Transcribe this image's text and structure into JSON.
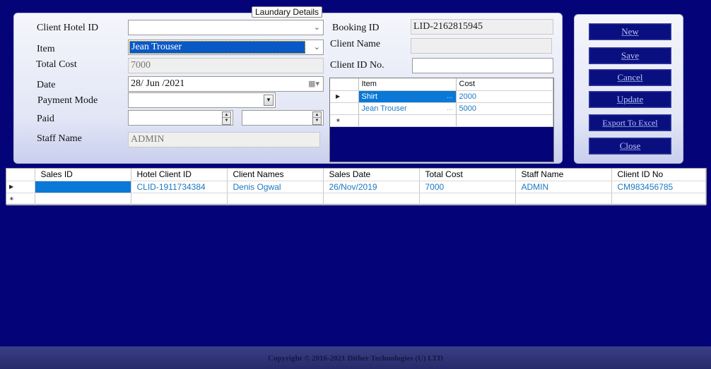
{
  "form": {
    "group_title": "Laundary Details",
    "client_hotel_id": {
      "label": "Client Hotel ID",
      "value": ""
    },
    "item": {
      "label": "Item",
      "value": "Jean Trouser"
    },
    "total_cost": {
      "label": "Total Cost",
      "value": "7000"
    },
    "date": {
      "label": "Date",
      "value": "28/ Jun /2021"
    },
    "payment_mode": {
      "label": "Payment Mode",
      "value": ""
    },
    "paid": {
      "label": "Paid",
      "value_1": "",
      "value_2": ""
    },
    "staff_name": {
      "label": "Staff Name",
      "value": "ADMIN"
    },
    "booking_id": {
      "label": "Booking ID",
      "value": "LID-2162815945"
    },
    "client_name": {
      "label": "Client Name",
      "value": ""
    },
    "client_id_no": {
      "label": "Client ID No.",
      "value": ""
    }
  },
  "items_grid": {
    "columns": [
      "Item",
      "Cost"
    ],
    "rows": [
      {
        "item": "Shirt",
        "cost": "2000",
        "selected": true
      },
      {
        "item": "Jean Trouser",
        "cost": "5000",
        "selected": false
      }
    ],
    "dots": "..."
  },
  "buttons": {
    "new": "New",
    "save": "Save",
    "cancel": "Cancel",
    "update": "Update",
    "export": "Export To Excel",
    "close": "Close"
  },
  "sales_grid": {
    "columns": [
      "Sales ID",
      "Hotel Client ID",
      "Client Names",
      "Sales Date",
      "Total Cost",
      "Staff Name",
      "Client ID No"
    ],
    "rows": [
      {
        "sales_id": "",
        "hotel_client_id": "CLID-1911734384",
        "client_names": "Denis Ogwal",
        "sales_date": "26/Nov/2019",
        "total_cost": "7000",
        "staff_name": "ADMIN",
        "client_id_no": "CM983456785"
      }
    ]
  },
  "footer": {
    "copyright": "Copyright ©  2016-2021 Dither Technologies (U) LTD"
  }
}
